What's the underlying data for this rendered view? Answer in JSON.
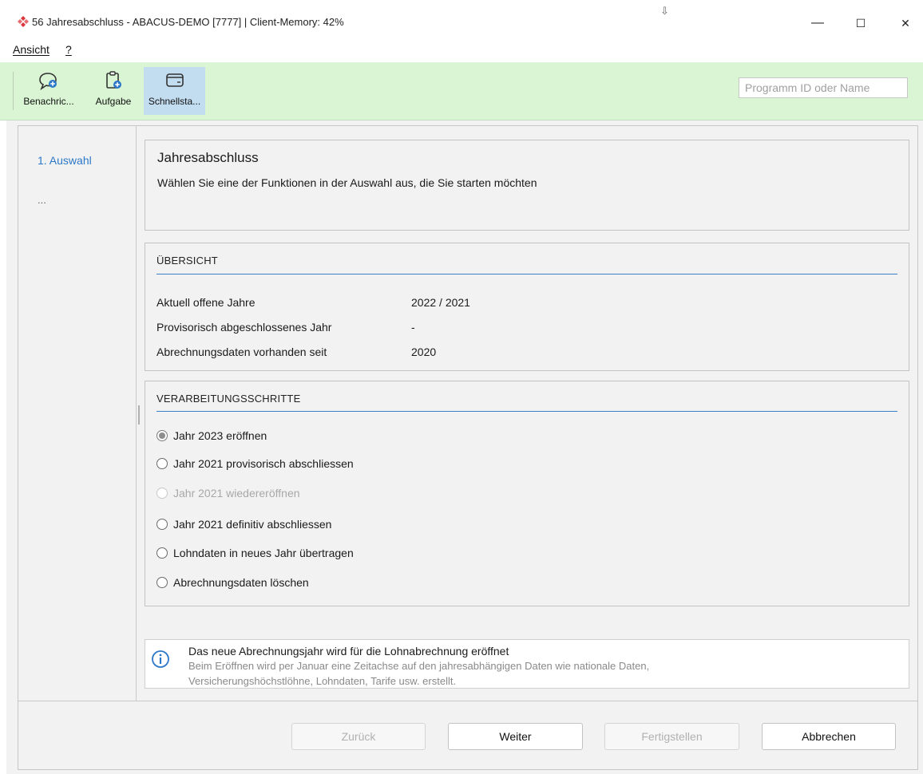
{
  "window": {
    "title": "56 Jahresabschluss - ABACUS-DEMO [7777] | Client-Memory: 42%",
    "minimize": "—",
    "maximize": "☐",
    "close": "✕",
    "drag_glyph": "⇩"
  },
  "menu": {
    "view": "Ansicht",
    "help": "?"
  },
  "toolbar": {
    "notification_label": "Benachric...",
    "task_label": "Aufgabe",
    "quickstart_label": "Schnellsta...",
    "search_placeholder": "Programm ID oder Name"
  },
  "steps_nav": {
    "step1": "1. Auswahl",
    "more": "..."
  },
  "header": {
    "title": "Jahresabschluss",
    "description": "Wählen Sie eine der Funktionen in der Auswahl aus, die Sie starten möchten"
  },
  "overview": {
    "title": "ÜBERSICHT",
    "rows": [
      {
        "label": "Aktuell offene Jahre",
        "value": "2022 / 2021"
      },
      {
        "label": "Provisorisch abgeschlossenes Jahr",
        "value": "-"
      },
      {
        "label": "Abrechnungsdaten vorhanden seit",
        "value": "2020"
      }
    ]
  },
  "processing": {
    "title": "VERARBEITUNGSSCHRITTE",
    "options": [
      {
        "label": "Jahr 2023 eröffnen",
        "checked": true,
        "disabled": false
      },
      {
        "label": "Jahr 2021 provisorisch abschliessen",
        "checked": false,
        "disabled": false
      },
      {
        "label": "Jahr 2021 wiedereröffnen",
        "checked": false,
        "disabled": true
      },
      {
        "label": "Jahr 2021 definitiv abschliessen",
        "checked": false,
        "disabled": false
      },
      {
        "label": "Lohndaten in neues Jahr übertragen",
        "checked": false,
        "disabled": false
      },
      {
        "label": "Abrechnungsdaten löschen",
        "checked": false,
        "disabled": false
      }
    ]
  },
  "info": {
    "heading": "Das neue Abrechnungsjahr wird für die Lohnabrechnung eröffnet",
    "line1": "Beim Eröffnen wird per Januar eine Zeitachse auf den jahresabhängigen Daten wie nationale Daten,",
    "line2": "Versicherungshöchstlöhne, Lohndaten, Tarife usw. erstellt."
  },
  "footer": {
    "back": "Zurück",
    "next": "Weiter",
    "finish": "Fertigstellen",
    "cancel": "Abbrechen"
  },
  "colors": {
    "toolbar_bg": "#d9f5d3",
    "accent_blue": "#2b78c8",
    "quickstart_highlight": "#c2dcf0",
    "logo_red": "#d9363e"
  }
}
